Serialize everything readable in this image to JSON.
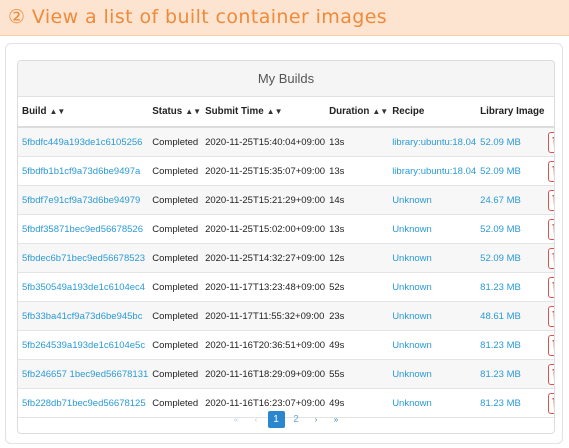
{
  "caption": {
    "marker": "②",
    "text": "View a list of built container images"
  },
  "panel": {
    "title": "My Builds"
  },
  "columns": {
    "build": "Build",
    "status": "Status",
    "submit_time": "Submit Time",
    "duration": "Duration",
    "recipe": "Recipe",
    "library_image": "Library Image"
  },
  "rows": [
    {
      "build": "5fbdfc449a193de1c6105256",
      "status": "Completed",
      "submit_time": "2020-11-25T15:40:04+09:00",
      "duration": "13s",
      "recipe": "library:ubuntu:18.04",
      "library_image": "52.09 MB"
    },
    {
      "build": "5fbdfb1b1cf9a73d6be9497a",
      "status": "Completed",
      "submit_time": "2020-11-25T15:35:07+09:00",
      "duration": "13s",
      "recipe": "library:ubuntu:18.04",
      "library_image": "52.09 MB"
    },
    {
      "build": "5fbdf7e91cf9a73d6be94979",
      "status": "Completed",
      "submit_time": "2020-11-25T15:21:29+09:00",
      "duration": "14s",
      "recipe": "Unknown",
      "library_image": "24.67 MB"
    },
    {
      "build": "5fbdf35871bec9ed56678526",
      "status": "Completed",
      "submit_time": "2020-11-25T15:02:00+09:00",
      "duration": "13s",
      "recipe": "Unknown",
      "library_image": "52.09 MB"
    },
    {
      "build": "5fbdec6b71bec9ed56678523",
      "status": "Completed",
      "submit_time": "2020-11-25T14:32:27+09:00",
      "duration": "12s",
      "recipe": "Unknown",
      "library_image": "52.09 MB"
    },
    {
      "build": "5fb350549a193de1c6104ec4",
      "status": "Completed",
      "submit_time": "2020-11-17T13:23:48+09:00",
      "duration": "52s",
      "recipe": "Unknown",
      "library_image": "81.23 MB"
    },
    {
      "build": "5fb33ba41cf9a73d6be945bc",
      "status": "Completed",
      "submit_time": "2020-11-17T11:55:32+09:00",
      "duration": "23s",
      "recipe": "Unknown",
      "library_image": "48.61 MB"
    },
    {
      "build": "5fb264539a193de1c6104e5c",
      "status": "Completed",
      "submit_time": "2020-11-16T20:36:51+09:00",
      "duration": "49s",
      "recipe": "Unknown",
      "library_image": "81.23 MB"
    },
    {
      "build": "5fb246657 1bec9ed56678131",
      "status": "Completed",
      "submit_time": "2020-11-16T18:29:09+09:00",
      "duration": "55s",
      "recipe": "Unknown",
      "library_image": "81.23 MB"
    },
    {
      "build": "5fb228db71bec9ed56678125",
      "status": "Completed",
      "submit_time": "2020-11-16T16:23:07+09:00",
      "duration": "49s",
      "recipe": "Unknown",
      "library_image": "81.23 MB"
    }
  ],
  "pagination": {
    "first": "«",
    "prev": "‹",
    "pages": [
      "1",
      "2"
    ],
    "current": "1",
    "next": "›",
    "last": "»"
  },
  "colors": {
    "accent": "#2b9ad6",
    "danger": "#d9534f",
    "caption_bg": "#fce4d0",
    "caption_fg": "#f08a3a"
  },
  "icons": {
    "sort": "sort-icon",
    "delete": "trash-icon"
  }
}
